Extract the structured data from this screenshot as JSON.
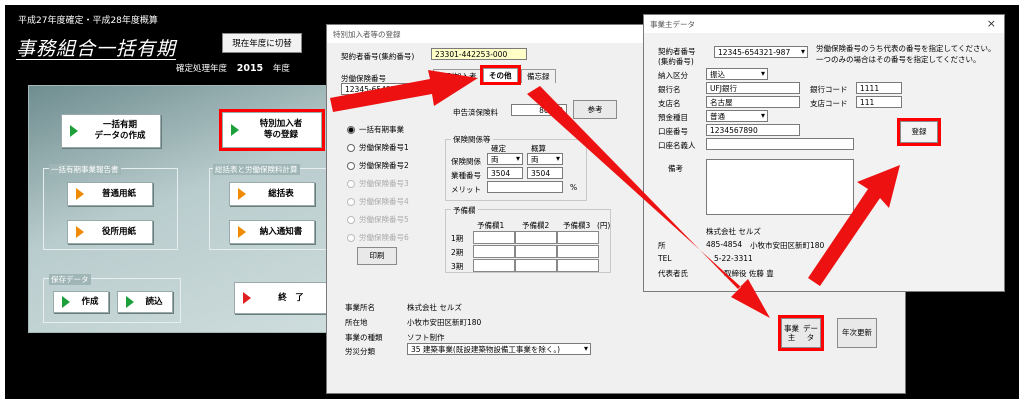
{
  "main": {
    "subtitle": "平成27年度確定・平成28年度概算",
    "title": "事務組合一括有期",
    "switch_button": "現在年度に切替",
    "fiscal_label": "確定処理年度",
    "fiscal_year": "2015",
    "fiscal_unit": "年度",
    "btn_data_create_line1": "一括有期",
    "btn_data_create_line2": "データの作成",
    "btn_special_line1": "特別加入者",
    "btn_special_line2": "等の登録",
    "group_report": "一括有期事業報告書",
    "btn_normal_paper": "普通用紙",
    "btn_office_paper": "役所用紙",
    "group_summary": "総括表と労働保険料計算",
    "btn_summary": "総括表",
    "btn_payment": "納入通知書",
    "group_save": "保存データ",
    "btn_save_create": "作成",
    "btn_save_load": "読込",
    "btn_exit": "終　了"
  },
  "special": {
    "window_title": "特別加入者等の登録",
    "contract_label": "契約者番号(集約番号)",
    "contract_value": "23301-442253-000",
    "insurance_label": "労働保険番号",
    "insurance_value": "12345-654321",
    "tab_other": "その他",
    "tab_memo": "備忘録",
    "tab_special": "特別加入者",
    "declared_label": "申告済保険料",
    "declared_value": "80000",
    "ref_button": "参考",
    "radio_1": "一括有期事業",
    "radio_2": "労働保険番号1",
    "radio_3": "労働保険番号2",
    "radio_4": "労働保険番号3",
    "radio_5": "労働保険番号4",
    "radio_6": "労働保険番号5",
    "radio_7": "労働保険番号6",
    "print_button": "印刷",
    "rel_group": "保険関係等",
    "col_confirmed": "確定",
    "col_estimated": "概算",
    "row_relation": "保険関係",
    "relation_confirmed": "両",
    "relation_estimated": "両",
    "row_industry": "業種番号",
    "industry_confirmed": "3504",
    "industry_estimated": "3504",
    "row_merit": "メリット",
    "merit_unit": "%",
    "reserve_group": "予備欄",
    "reserve_col1": "予備欄1",
    "reserve_col2": "予備欄2",
    "reserve_col3": "予備欄3",
    "reserve_unit": "(円)",
    "period_1": "1期",
    "period_2": "2期",
    "period_3": "3期",
    "office_name_label": "事業所名",
    "office_name_value": "株式会社 セルズ",
    "location_label": "所在地",
    "location_value": "小牧市安田区新町180",
    "business_type_label": "事業の種類",
    "business_type_value": "ソフト制作",
    "accident_label": "労災分類",
    "accident_value": "35 建築事業(既設建築物設備工事業を除く。)",
    "employer_button_line1": "事業主",
    "employer_button_line2": "データ",
    "annual_button_line1": "年次",
    "annual_button_line2": "更新"
  },
  "employer": {
    "window_title": "事業主データ",
    "close_glyph": "×",
    "contract_label_line1": "契約者番号",
    "contract_label_line2": "(集約番号)",
    "contract_value": "12345-654321-987",
    "note_line1": "労働保険番号のうち代表の番号を指定してください。",
    "note_line2": "一つのみの場合はその番号を指定してください。",
    "payment_label": "納入区分",
    "payment_value": "振込",
    "bank_label": "銀行名",
    "bank_value": "UFJ銀行",
    "bank_code_label": "銀行コード",
    "bank_code_value": "1111",
    "branch_label": "支店名",
    "branch_value": "名古屋",
    "branch_code_label": "支店コード",
    "branch_code_value": "111",
    "deposit_label": "預金種目",
    "deposit_value": "普通",
    "account_label": "口座番号",
    "account_value": "1234567890",
    "holder_label": "口座名義人",
    "register_button": "登録",
    "memo_label": "備考",
    "company_name": "株式会社 セルズ",
    "postal_partial": "485-4854",
    "address_value": "小牧市安田区新町180",
    "address_label": "所",
    "tel_label": "TEL",
    "tel_partial": "5-22-3311",
    "rep_label": "代表者氏",
    "rep_partial": "取締役 佐藤 豊"
  },
  "colors": {
    "highlight": "#ff0000",
    "arrow": "#ee1111",
    "background": "#000000"
  }
}
